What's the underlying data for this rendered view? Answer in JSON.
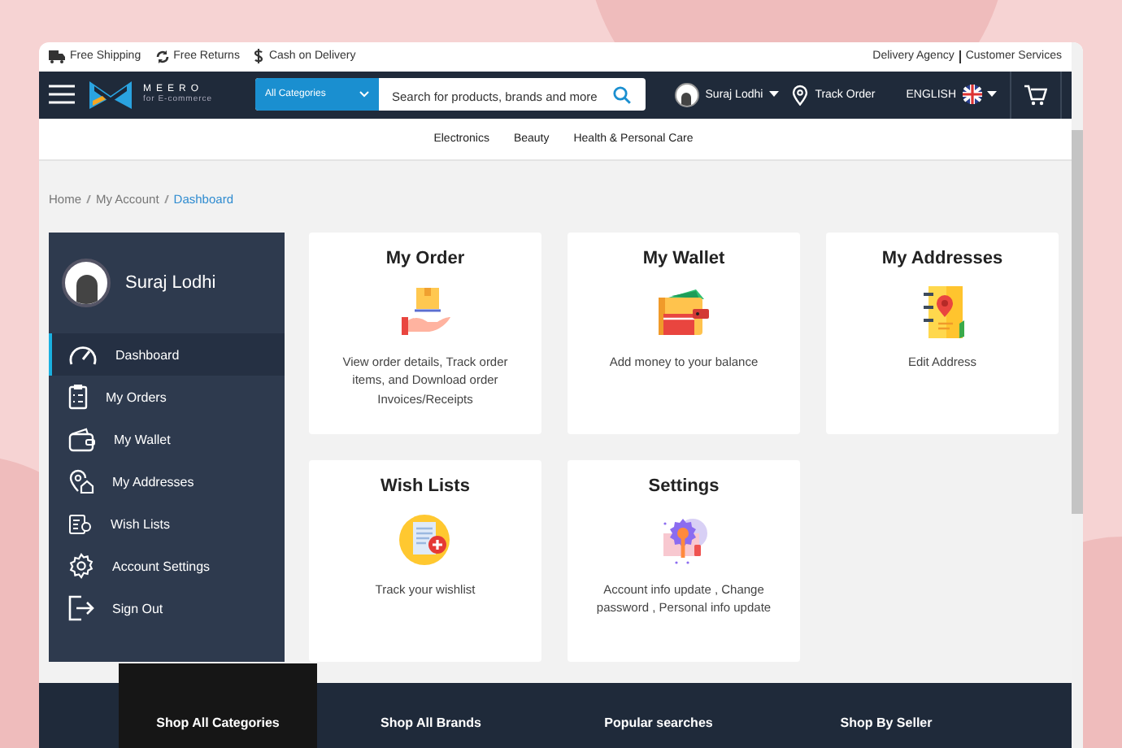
{
  "top_bar": {
    "perks": [
      "Free Shipping",
      "Free Returns",
      "Cash on Delivery"
    ],
    "links": [
      "Delivery Agency",
      "Customer Services"
    ]
  },
  "header": {
    "logo": {
      "name": "MEERO",
      "tagline": "for E-commerce"
    },
    "search": {
      "category": "All Categories",
      "placeholder": "Search for products, brands and more"
    },
    "user": "Suraj Lodhi",
    "track_order": "Track Order",
    "language": "ENGLISH"
  },
  "categories": [
    "Electronics",
    "Beauty",
    "Health & Personal Care"
  ],
  "breadcrumb": [
    {
      "label": "Home",
      "selected": false
    },
    {
      "label": "My Account",
      "selected": false
    },
    {
      "label": "Dashboard",
      "selected": true
    }
  ],
  "sidebar": {
    "user_name": "Suraj Lodhi",
    "items": [
      {
        "label": "Dashboard",
        "selected": true
      },
      {
        "label": "My Orders",
        "selected": false
      },
      {
        "label": "My Wallet",
        "selected": false
      },
      {
        "label": "My Addresses",
        "selected": false
      },
      {
        "label": "Wish Lists",
        "selected": false
      },
      {
        "label": "Account Settings",
        "selected": false
      },
      {
        "label": "Sign Out",
        "selected": false
      }
    ]
  },
  "cards": [
    {
      "title": "My Order",
      "description": "View order details, Track order items, and Download order Invoices/Receipts"
    },
    {
      "title": "My Wallet",
      "description": "Add money to your balance"
    },
    {
      "title": "My Addresses",
      "description": "Edit Address"
    },
    {
      "title": "Wish Lists",
      "description": "Track your wishlist"
    },
    {
      "title": "Settings",
      "description": "Account info update , Change password , Personal info update"
    }
  ],
  "footer_tabs": [
    {
      "label": "Shop All Categories",
      "selected": true
    },
    {
      "label": "Shop All Brands",
      "selected": false
    },
    {
      "label": "Popular searches",
      "selected": false
    },
    {
      "label": "Shop By Seller",
      "selected": false
    }
  ]
}
